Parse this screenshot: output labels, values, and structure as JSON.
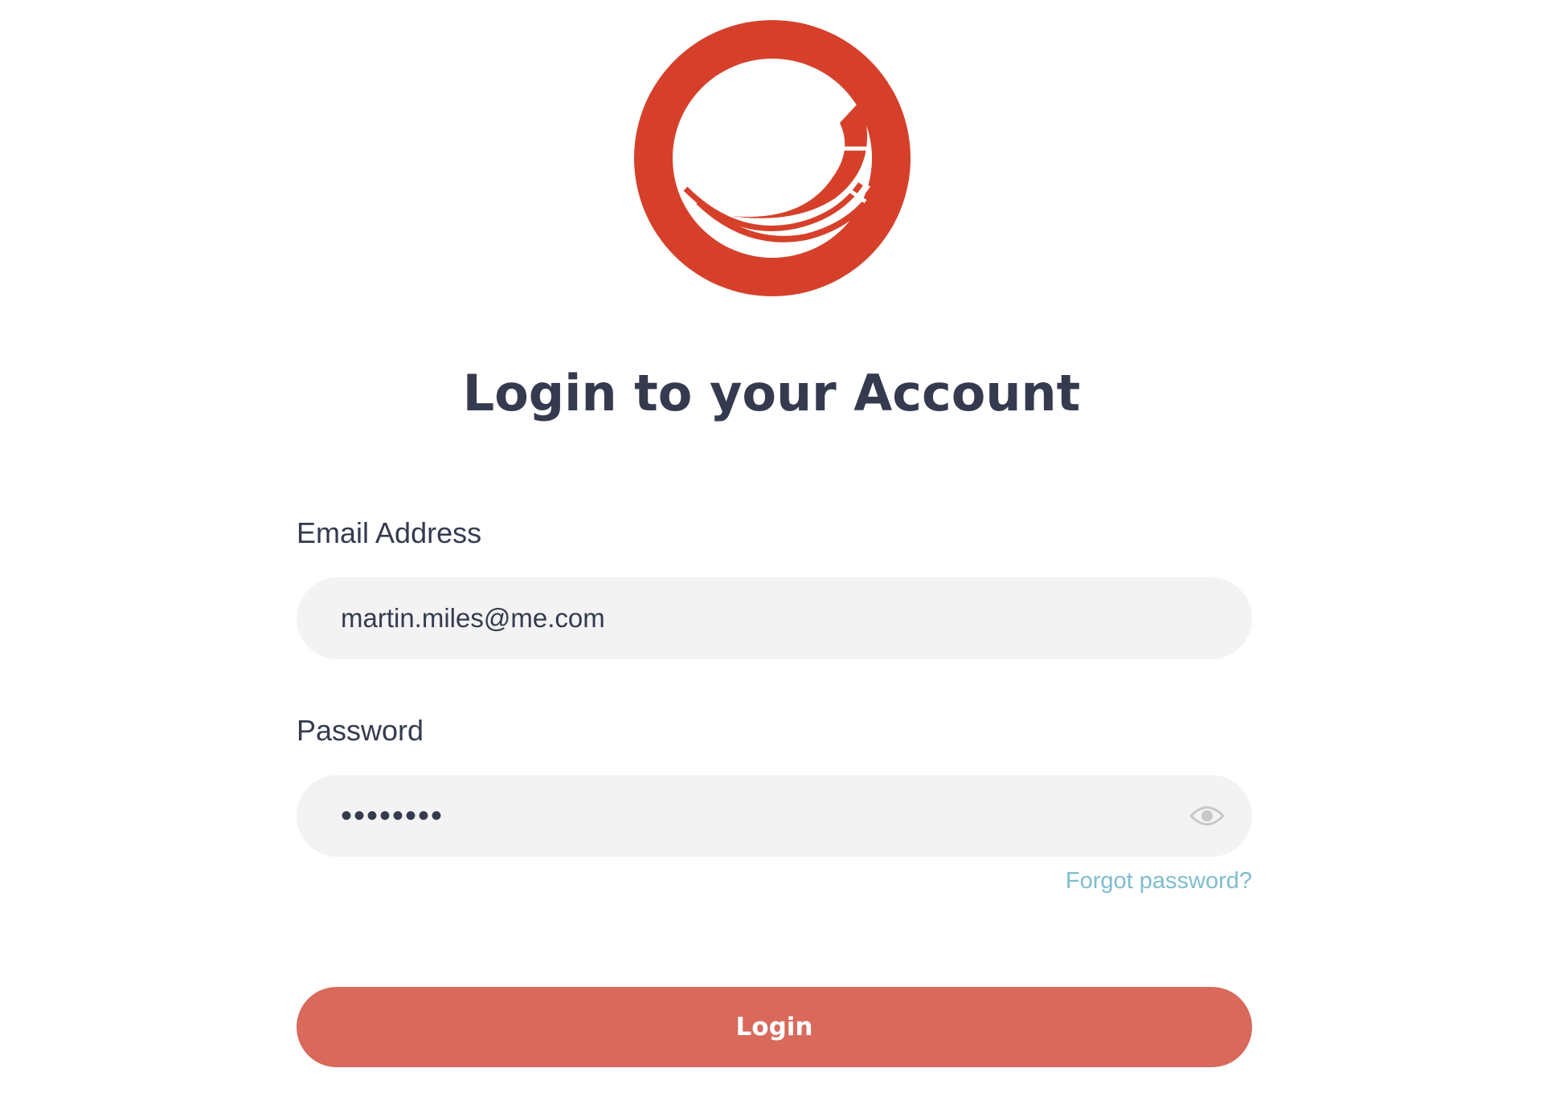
{
  "brand": {
    "logo_icon": "sitecore-logo-icon",
    "color": "#d6402a"
  },
  "page": {
    "title": "Login to your Account"
  },
  "form": {
    "email": {
      "label": "Email Address",
      "value": "martin.miles@me.com"
    },
    "password": {
      "label": "Password",
      "value": "••••••••",
      "toggle_icon": "eye-icon"
    },
    "forgot_link": "Forgot password?",
    "submit_label": "Login"
  },
  "colors": {
    "text": "#353a4f",
    "field_background": "#f3f3f3",
    "link": "#7fbdd0",
    "button": "#d9695b"
  }
}
